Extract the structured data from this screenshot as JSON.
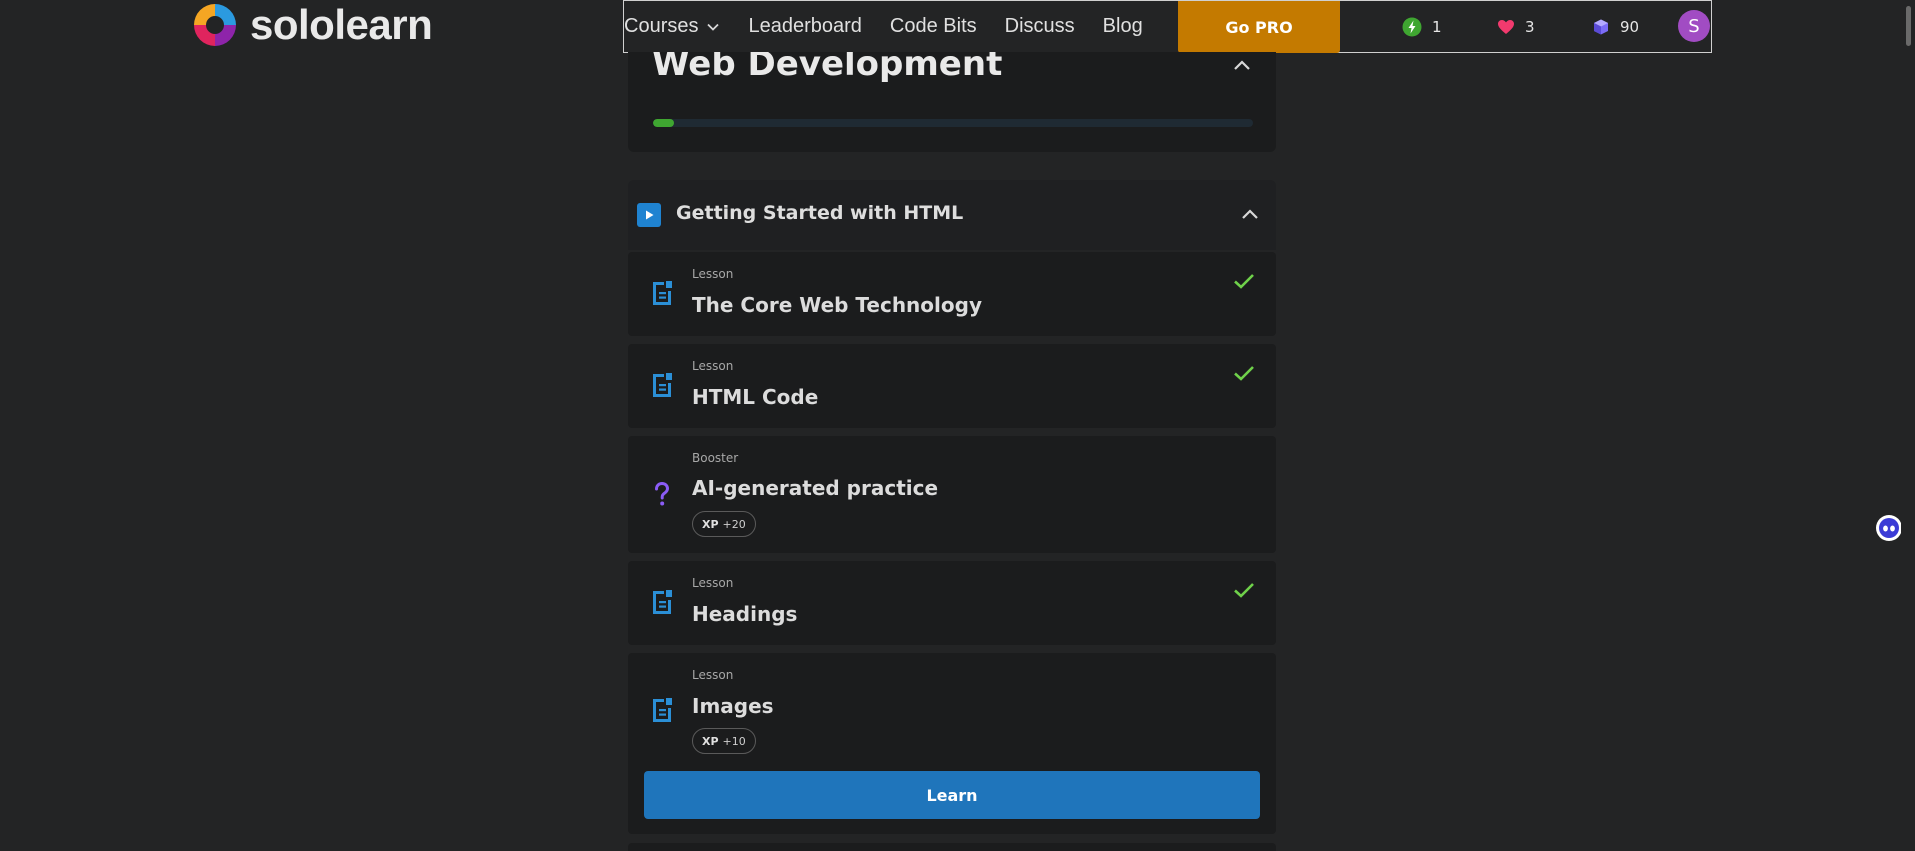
{
  "brand": {
    "name": "sololearn"
  },
  "nav": {
    "links": [
      {
        "label": "Courses",
        "has_dropdown": true
      },
      {
        "label": "Leaderboard"
      },
      {
        "label": "Code Bits"
      },
      {
        "label": "Discuss"
      },
      {
        "label": "Blog"
      }
    ],
    "go_pro_label": "Go PRO",
    "stats": {
      "streak": "1",
      "hearts": "3",
      "gems": "90"
    },
    "avatar_initial": "S"
  },
  "course": {
    "title": "Web Development",
    "progress": 0.035
  },
  "module": {
    "title": "Getting Started with HTML"
  },
  "items": [
    {
      "type": "Lesson",
      "title": "The Core Web Technology",
      "completed": true
    },
    {
      "type": "Lesson",
      "title": "HTML Code",
      "completed": true
    },
    {
      "type": "Booster",
      "title": "AI-generated practice",
      "xp_label": "XP",
      "xp_value": "+20"
    },
    {
      "type": "Lesson",
      "title": "Headings",
      "completed": true
    },
    {
      "type": "Lesson",
      "title": "Images",
      "xp_label": "XP",
      "xp_value": "+10",
      "cta": "Learn"
    }
  ],
  "colors": {
    "accent_blue": "#1f75bb",
    "check_green": "#6fd14a",
    "progress_green": "#3fa631",
    "pro_orange": "#c47a00",
    "booster_purple": "#8b5cf6"
  }
}
